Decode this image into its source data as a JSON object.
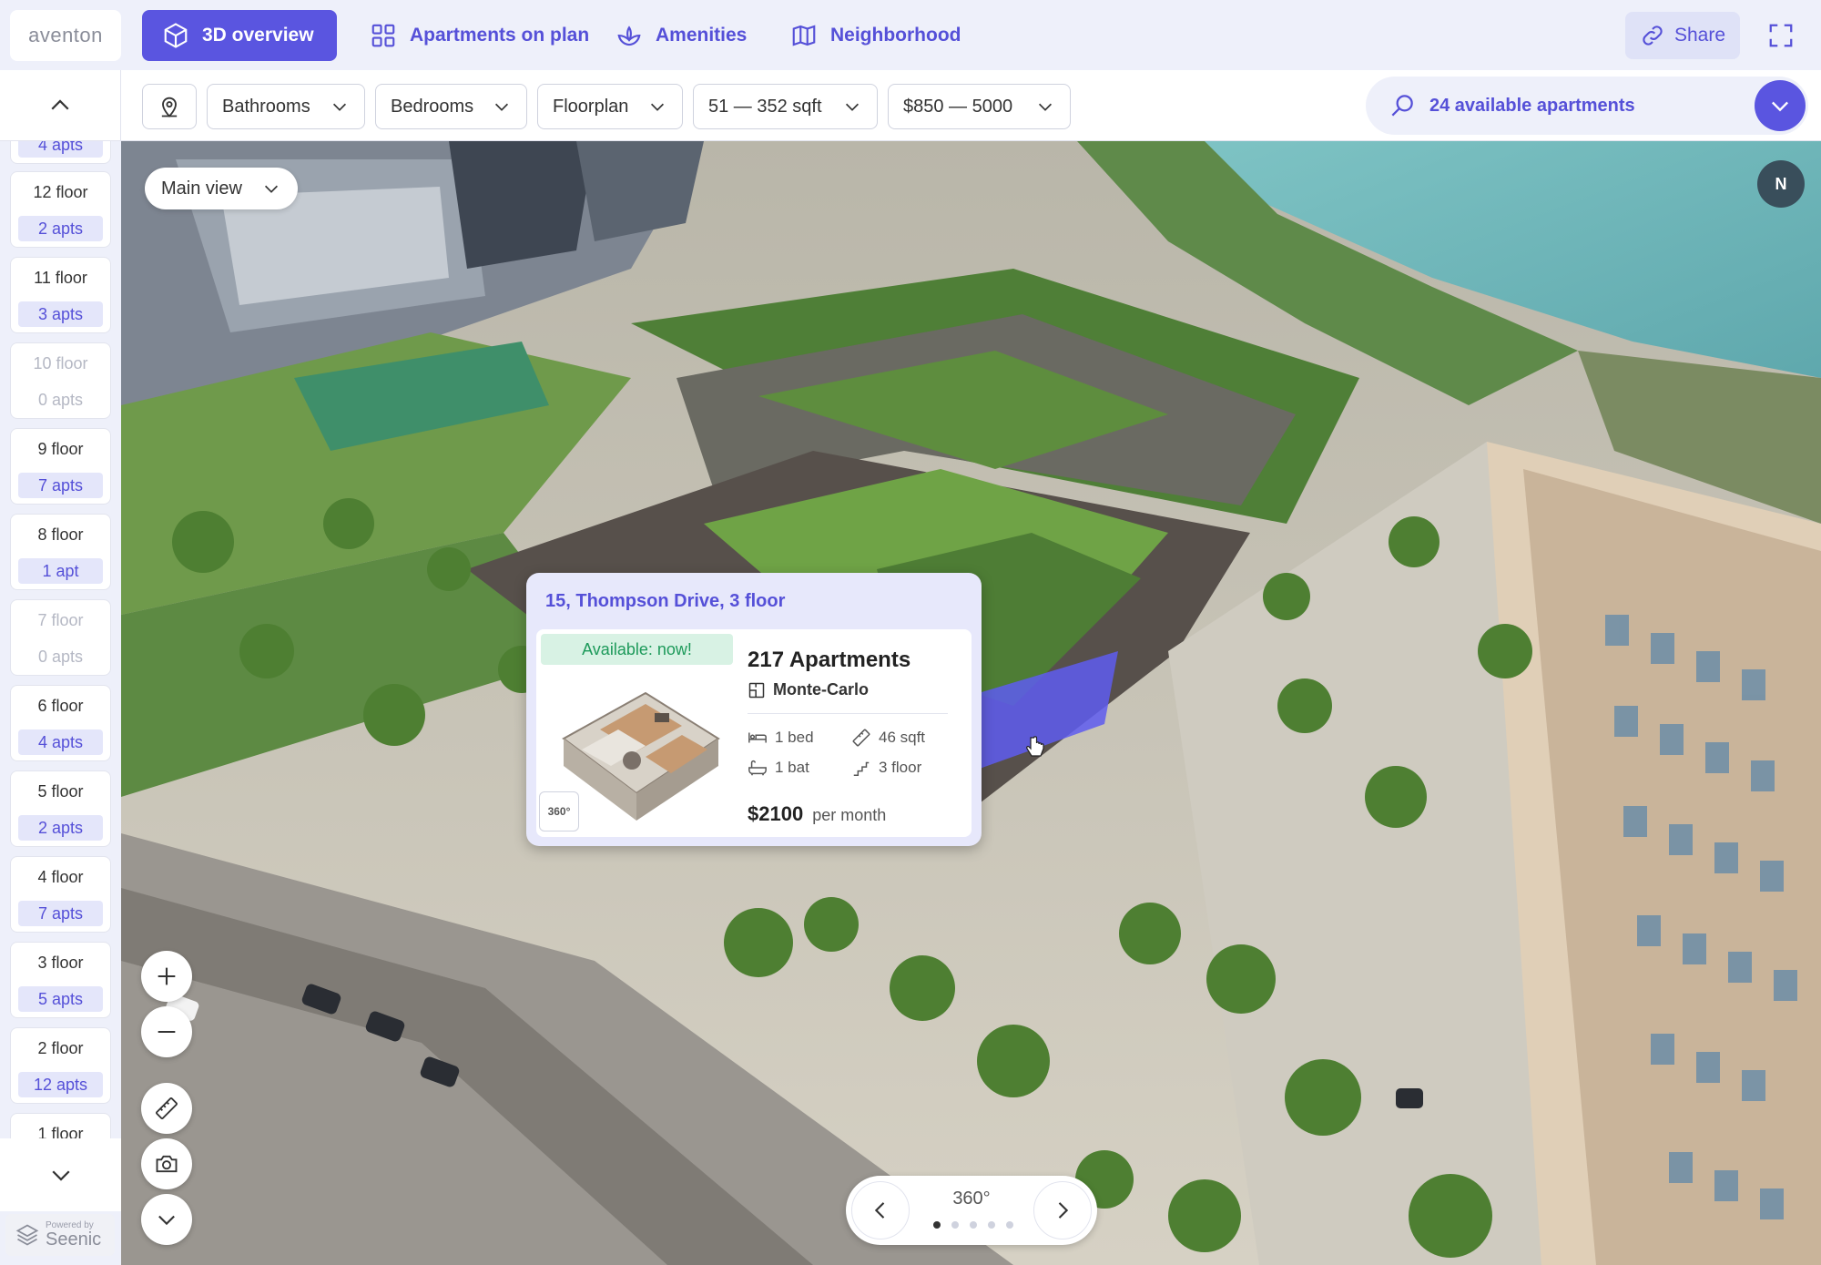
{
  "header": {
    "logo": "aventon",
    "tabs": [
      {
        "label": "3D overview",
        "icon": "cube-icon",
        "active": true
      },
      {
        "label": "Apartments on plan",
        "icon": "grid-icon",
        "active": false
      },
      {
        "label": "Amenities",
        "icon": "lotus-icon",
        "active": false
      },
      {
        "label": "Neighborhood",
        "icon": "map-icon",
        "active": false
      }
    ],
    "share_label": "Share"
  },
  "filters": {
    "bathrooms": "Bathrooms",
    "bedrooms": "Bedrooms",
    "floorplan": "Floorplan",
    "area": "51 — 352 sqft",
    "price": "$850 — 5000",
    "available_count": "24 available apartments"
  },
  "floors": [
    {
      "label": "",
      "apts": "4 apts",
      "empty": false
    },
    {
      "label": "12 floor",
      "apts": "2 apts",
      "empty": false
    },
    {
      "label": "11 floor",
      "apts": "3 apts",
      "empty": false
    },
    {
      "label": "10 floor",
      "apts": "0 apts",
      "empty": true
    },
    {
      "label": "9 floor",
      "apts": "7 apts",
      "empty": false
    },
    {
      "label": "8 floor",
      "apts": "1 apt",
      "empty": false
    },
    {
      "label": "7 floor",
      "apts": "0 apts",
      "empty": true
    },
    {
      "label": "6 floor",
      "apts": "4 apts",
      "empty": false
    },
    {
      "label": "5 floor",
      "apts": "2 apts",
      "empty": false
    },
    {
      "label": "4 floor",
      "apts": "7 apts",
      "empty": false
    },
    {
      "label": "3 floor",
      "apts": "5 apts",
      "empty": false
    },
    {
      "label": "2 floor",
      "apts": "12 apts",
      "empty": false
    },
    {
      "label": "1 floor",
      "apts": "",
      "empty": false
    }
  ],
  "powered_by": {
    "small": "Powered by",
    "brand": "Seenic"
  },
  "viewport": {
    "view_select": "Main view",
    "compass": "N",
    "rotate_label": "360°",
    "active_dot": 0
  },
  "popup": {
    "address": "15, Thompson Drive, 3 floor",
    "availability": "Available: now!",
    "name": "217 Apartments",
    "floorplan": "Monte-Carlo",
    "beds": "1 bed",
    "area": "46 sqft",
    "baths": "1 bat",
    "floor": "3 floor",
    "price": "$2100",
    "price_unit": "per month",
    "pano_label": "360°"
  },
  "colors": {
    "accent": "#5a55e0",
    "accent_text": "#5550d8",
    "available": "#1d9a5a",
    "highlight": "#5e5cf0"
  }
}
